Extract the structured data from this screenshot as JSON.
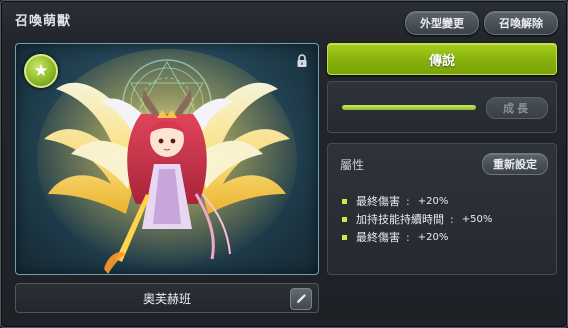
{
  "window": {
    "title": "召喚萌獸"
  },
  "header": {
    "appearance_label": "外型變更",
    "dismiss_label": "召喚解除"
  },
  "pet": {
    "name": "奧芙赫班",
    "rarity": "傳說"
  },
  "growth": {
    "button_label": "成長",
    "progress": 1.0
  },
  "attributes": {
    "title": "屬性",
    "reset_label": "重新設定",
    "items": [
      {
        "name": "最終傷害",
        "sep": ":",
        "value": "+20%"
      },
      {
        "name": "加持技能持續時間",
        "sep": ":",
        "value": "+50%"
      },
      {
        "name": "最終傷害",
        "sep": ":",
        "value": "+20%"
      }
    ]
  },
  "colors": {
    "rarity_green": "#8fbb12",
    "bullet": "#cfe74b",
    "portrait_bg": "#25485a"
  },
  "icons": {
    "badge": "star-icon",
    "lock": "lock-icon",
    "edit": "pencil-icon"
  }
}
